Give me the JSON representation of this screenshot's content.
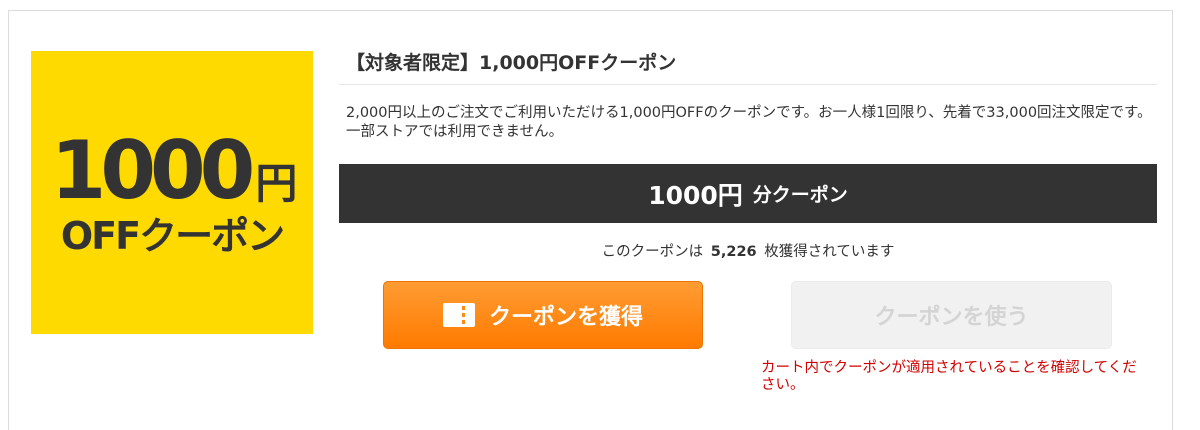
{
  "coupon_image": {
    "amount": "1000",
    "yen": "円",
    "off_text": "OFFクーポン",
    "background_color": "#ffda00"
  },
  "coupon": {
    "title": "【対象者限定】1,000円OFFクーポン",
    "description": "2,000円以上のご注文でご利用いただける1,000円OFFのクーポンです。お一人様1回限り、先着で33,000回注文限定です。一部ストアでは利用できません。",
    "value_amount": "1000円",
    "value_unit": "分クーポン",
    "acquired_prefix": "このクーポンは",
    "acquired_count": "5,226",
    "acquired_suffix": "枚獲得されています"
  },
  "buttons": {
    "get_label": "クーポンを獲得",
    "get_icon": "ticket-icon",
    "use_label": "クーポンを使う"
  },
  "notice": "カート内でクーポンが適用されていることを確認してください。",
  "colors": {
    "accent_orange": "#ff8a14",
    "dark_bar": "#333333",
    "notice_red": "#d10000",
    "disabled_gray": "#f1f1f1"
  }
}
